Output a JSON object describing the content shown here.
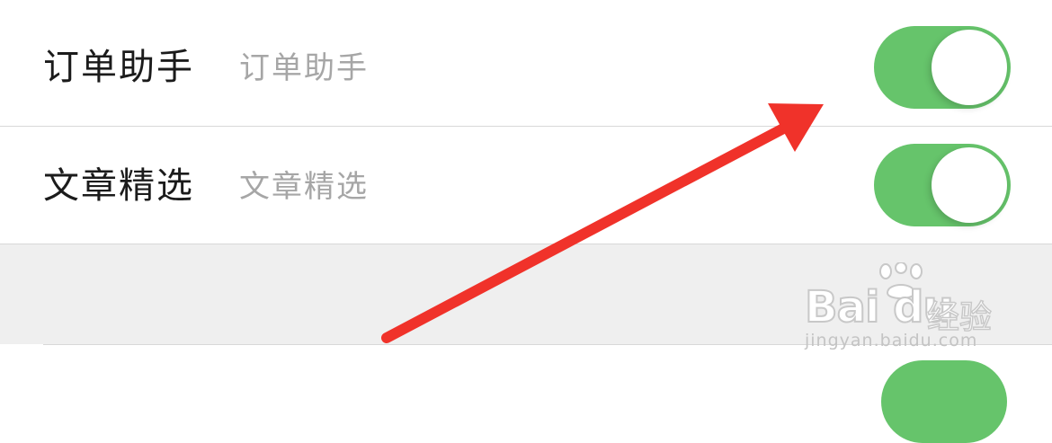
{
  "settings": {
    "rows": [
      {
        "title": "订单助手",
        "subtitle": "订单助手",
        "toggle_on": true
      },
      {
        "title": "文章精选",
        "subtitle": "文章精选",
        "toggle_on": true
      }
    ]
  },
  "watermark": {
    "brand": "Bai du",
    "brand_cn": "经验",
    "url": "jingyan.baidu.com"
  },
  "colors": {
    "toggle_on": "#66c46b",
    "arrow": "#f0322a",
    "section_gap": "#efefef"
  },
  "icons": {
    "paw": "paw-icon",
    "arrow": "red-arrow-annotation"
  }
}
